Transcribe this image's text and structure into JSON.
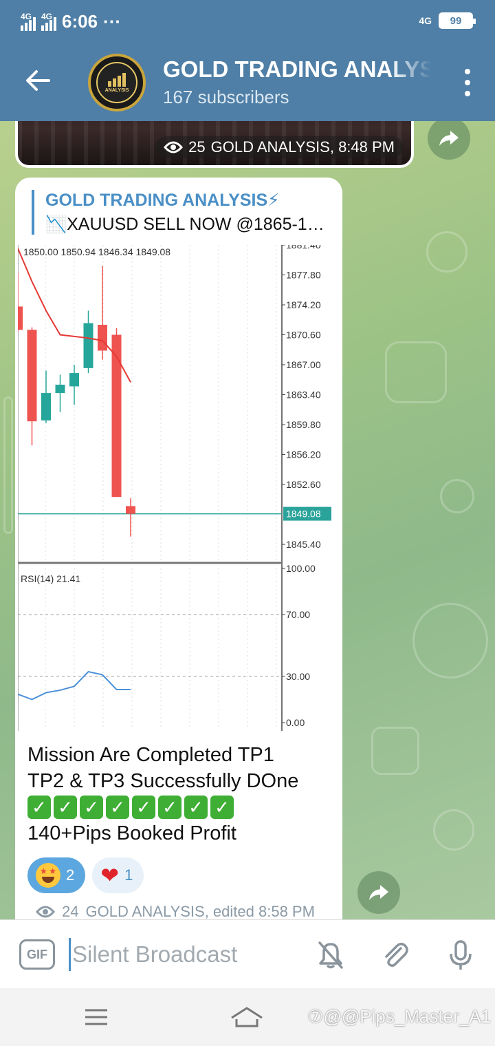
{
  "status_bar": {
    "network_1": "4G",
    "network_2": "4G",
    "time": "6:06",
    "dots": "···",
    "network_right": "4G",
    "battery": "99"
  },
  "header": {
    "title": "GOLD TRADING ANALYSIS",
    "subscribers": "167 subscribers",
    "avatar_text": "ANALYSIS"
  },
  "previous_message": {
    "views": "25",
    "author_time": "GOLD ANALYSIS, 8:48 PM"
  },
  "message": {
    "reply_name": "GOLD TRADING ANALYSIS⚡",
    "reply_text": "📉XAUUSD SELL NOW @1865-1…",
    "text_line_1": "Mission Are Completed TP1",
    "text_line_2": "TP2 & TP3 Successfully DOne",
    "check_count": 8,
    "text_line_4": "140+Pips Booked Profit",
    "reactions": [
      {
        "emoji": "star-struck",
        "count": "2"
      },
      {
        "emoji": "heart",
        "count": "1"
      }
    ],
    "views": "24",
    "author_time": "GOLD ANALYSIS, edited 8:58 PM"
  },
  "chart_data": {
    "type": "candlestick",
    "ohlc_label": "1850.00 1850.94 1846.34 1849.08",
    "price_axis": {
      "ticks": [
        "1881.40",
        "1877.80",
        "1874.20",
        "1870.60",
        "1867.00",
        "1863.40",
        "1859.80",
        "1856.20",
        "1852.60",
        "1845.40"
      ],
      "ylim": [
        1843.5,
        1881.4
      ],
      "current_price": "1849.08",
      "current_value": 1849.08
    },
    "candles": [
      {
        "o": 1874.0,
        "h": 1878.0,
        "l": 1871.0,
        "c": 1871.2
      },
      {
        "o": 1871.2,
        "h": 1871.5,
        "l": 1857.3,
        "c": 1860.2
      },
      {
        "o": 1860.3,
        "h": 1866.3,
        "l": 1860.0,
        "c": 1863.6
      },
      {
        "o": 1863.6,
        "h": 1865.8,
        "l": 1861.3,
        "c": 1864.6
      },
      {
        "o": 1864.4,
        "h": 1867.0,
        "l": 1862.2,
        "c": 1866.0
      },
      {
        "o": 1866.6,
        "h": 1873.5,
        "l": 1866.0,
        "c": 1872.0
      },
      {
        "o": 1871.8,
        "h": 1878.9,
        "l": 1867.6,
        "c": 1868.7
      },
      {
        "o": 1870.6,
        "h": 1871.4,
        "l": 1851.1,
        "c": 1851.1
      },
      {
        "o": 1850.0,
        "h": 1850.94,
        "l": 1846.34,
        "c": 1849.08
      }
    ],
    "ma_line": [
      1881.0,
      1877.0,
      1873.5,
      1870.6,
      1870.4,
      1870.2,
      1869.9,
      1868.0,
      1864.9
    ],
    "rsi": {
      "label": "RSI(14) 21.41",
      "ticks": [
        "100.00",
        "70.00",
        "30.00",
        "0.00"
      ],
      "ylim": [
        0,
        100
      ],
      "values": [
        18.4,
        15.0,
        19.4,
        21.0,
        23.5,
        33.0,
        31.0,
        21.41,
        21.41
      ]
    }
  },
  "input_bar": {
    "gif_label": "GIF",
    "placeholder": "Silent Broadcast"
  },
  "watermark": "⑦@@Pips_Master_A1"
}
